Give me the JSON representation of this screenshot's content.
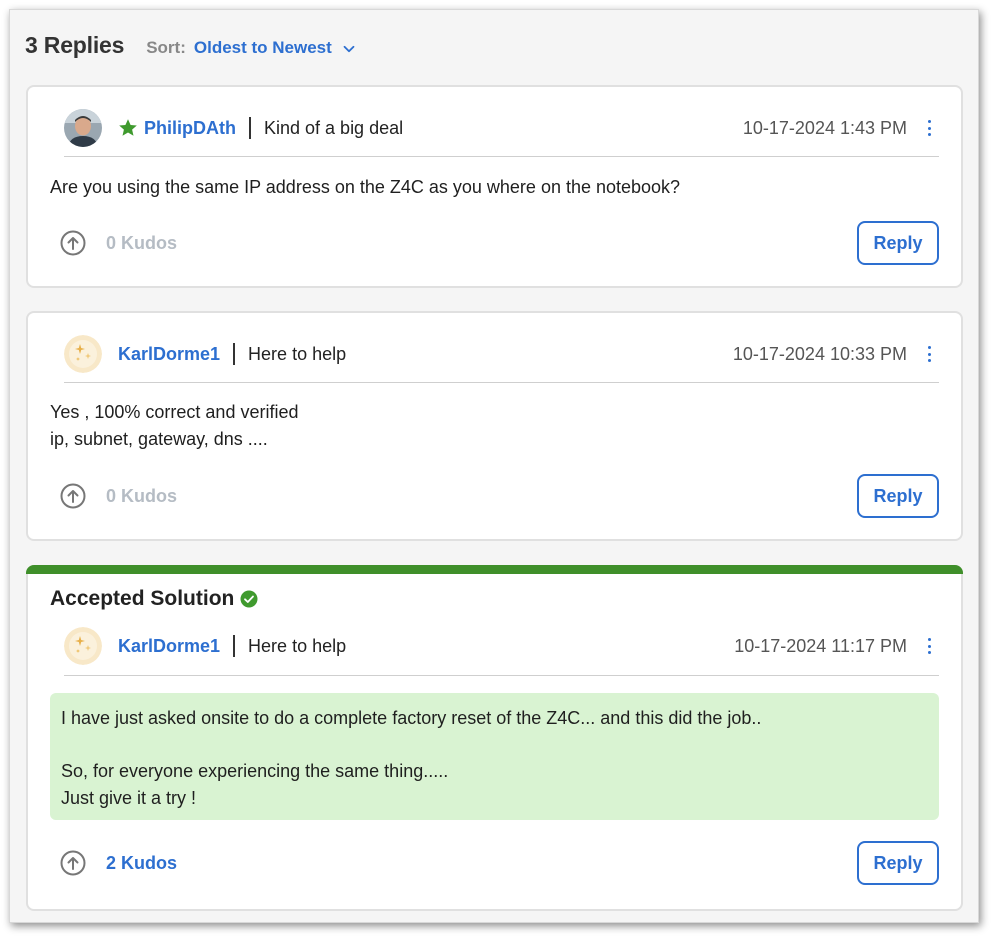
{
  "header": {
    "replies_count": "3 Replies",
    "sort_label": "Sort:",
    "sort_value": "Oldest to Newest"
  },
  "posts": [
    {
      "author": "PhilipDAth",
      "rank": "Kind of a big deal",
      "date": "10-17-2024 1:43 PM",
      "body": [
        "Are you using the same IP address on the Z4C as you where on the notebook?"
      ],
      "kudos": "0 Kudos",
      "reply_label": "Reply",
      "avatar_icon": "user-photo-avatar",
      "rank_icon": "star-icon"
    },
    {
      "author": "KarlDorme1",
      "rank": "Here to help",
      "date": "10-17-2024 10:33 PM",
      "body": [
        "Yes , 100% correct and verified",
        "ip, subnet, gateway, dns ...."
      ],
      "kudos": "0 Kudos",
      "reply_label": "Reply",
      "avatar_icon": "sparkle-avatar"
    },
    {
      "accepted_label": "Accepted Solution",
      "author": "KarlDorme1",
      "rank": "Here to help",
      "date": "10-17-2024 11:17 PM",
      "body": [
        "I have just asked onsite to do a complete factory reset of the Z4C... and this did the job..",
        "",
        "So, for everyone experiencing the same thing.....",
        "Just give it a try !"
      ],
      "kudos": "2 Kudos",
      "reply_label": "Reply",
      "avatar_icon": "sparkle-avatar"
    }
  ],
  "colors": {
    "link": "#2d6fd0",
    "accepted_bar": "#3f8f2a",
    "solution_bg": "#d9f3d2",
    "star": "#3f9a2e",
    "kudos_inactive": "#b5bcc4"
  }
}
